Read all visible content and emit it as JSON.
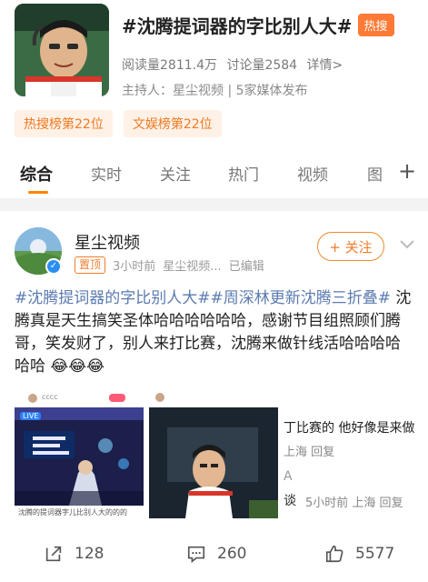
{
  "topic": {
    "title": "#沈腾提词器的字比别人大#",
    "hot_badge": "热搜",
    "read_count": "阅读量2811.4万",
    "discuss_count": "讨论量2584",
    "detail_link": "详情>",
    "host": "主持人：星尘视频 | 5家媒体发布",
    "ranks": [
      "热搜榜第22位",
      "文娱榜第22位"
    ]
  },
  "tabs": [
    "综合",
    "实时",
    "关注",
    "热门",
    "视频",
    "图"
  ],
  "tab_plus": "+",
  "post": {
    "author": "星尘视频",
    "pin_badge": "置顶",
    "time": "3小时前",
    "source": "星尘视频...",
    "edited": "已编辑",
    "follow_label": "+ 关注",
    "text_tag1": "#沈腾提词器的字比别人大#",
    "text_tag2": "#周深林更新沈腾三折叠#",
    "text_body": " 沈腾真是天生搞笑圣体哈哈哈哈哈哈，感谢节目组照顾们腾哥，笑发财了，别人来打比赛，沈腾来做针线活哈哈哈哈哈哈 😂😂😂",
    "thumb1": {
      "live_badge": "LIVE",
      "username": "cccc",
      "caption": "沈腾的提词器字儿比别人大的的的"
    },
    "comments_preview": {
      "line1": "丁比赛的 他好像是来做",
      "line1_meta": "上海 回复",
      "line2_name": "A",
      "line2_name2": "谈",
      "line2_meta": "5小时前 上海 回复"
    },
    "actions": {
      "repost": "128",
      "comment": "260",
      "like": "5577"
    }
  },
  "colors": {
    "accent_orange": "#ff8200",
    "tag_blue": "#5b7bb0",
    "hot_badge": "#ff7a35"
  }
}
